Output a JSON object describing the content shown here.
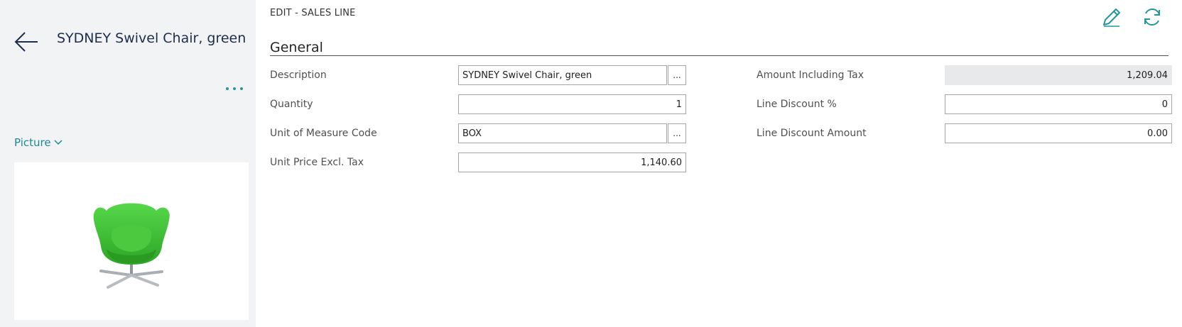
{
  "left_pane": {
    "title": "SYDNEY Swivel Chair, green",
    "picture_label": "Picture",
    "picture": {
      "description": "green swivel chair",
      "color": "#3cbf2f"
    }
  },
  "header": {
    "caption": "EDIT - SALES LINE",
    "edit_icon": "pencil-icon",
    "refresh_icon": "refresh-icon",
    "accent_color": "#2496a2"
  },
  "general": {
    "title": "General",
    "left_fields": [
      {
        "label": "Description",
        "value": "SYDNEY Swivel Chair, green",
        "has_assist": true,
        "assist_label": "...",
        "align": "left"
      },
      {
        "label": "Quantity",
        "value": "1",
        "has_assist": false,
        "align": "right"
      },
      {
        "label": "Unit of Measure Code",
        "value": "BOX",
        "has_assist": true,
        "assist_label": "...",
        "align": "left"
      },
      {
        "label": "Unit Price Excl. Tax",
        "value": "1,140.60",
        "has_assist": false,
        "align": "right"
      }
    ],
    "right_fields": [
      {
        "label": "Amount Including Tax",
        "value": "1,209.04",
        "readonly": true,
        "align": "right"
      },
      {
        "label": "Line Discount %",
        "value": "0",
        "readonly": false,
        "align": "right"
      },
      {
        "label": "Line Discount Amount",
        "value": "0.00",
        "readonly": false,
        "align": "right"
      }
    ]
  }
}
